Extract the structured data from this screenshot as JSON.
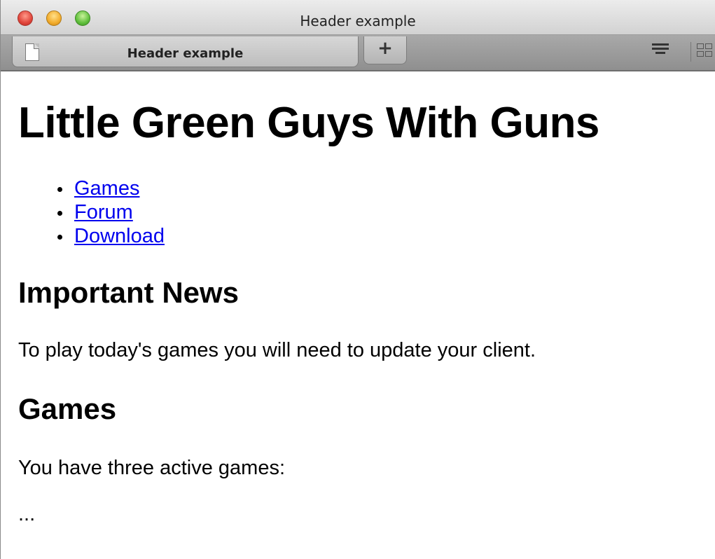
{
  "window": {
    "title": "Header example"
  },
  "tabs": [
    {
      "label": "Header example",
      "active": true
    }
  ],
  "toolbar": {
    "new_tab_label": "+"
  },
  "page": {
    "heading": "Little Green Guys With Guns",
    "nav_links": [
      "Games",
      "Forum",
      "Download"
    ],
    "sections": [
      {
        "heading": "Important News",
        "text": "To play today's games you will need to update your client."
      },
      {
        "heading": "Games",
        "text": "You have three active games:"
      }
    ],
    "trailing_text": "..."
  },
  "colors": {
    "link": "#0000ee",
    "close": "#e0443a",
    "minimize": "#f2ac2c",
    "maximize": "#5fbf3c"
  }
}
